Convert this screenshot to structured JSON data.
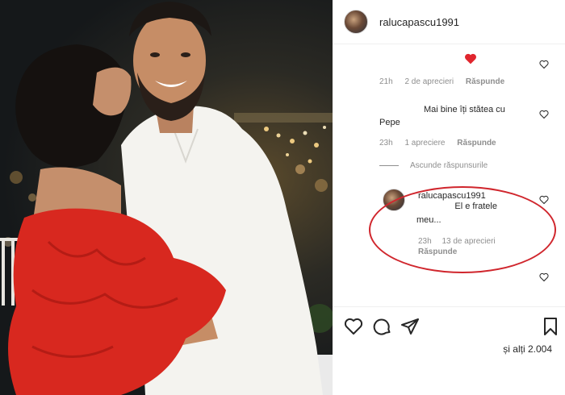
{
  "post": {
    "username": "ralucapascu1991"
  },
  "comments": [
    {
      "text": "",
      "has_red_heart": true,
      "time": "21h",
      "likes": "2 de aprecieri",
      "reply_label": "Răspunde"
    },
    {
      "text_line1": "Mai bine îți stătea cu",
      "text_line2": "Pepe",
      "time": "23h",
      "likes": "1 apreciere",
      "reply_label": "Răspunde"
    }
  ],
  "hide_replies_label": "Ascunde răspunsurile",
  "reply": {
    "username": "ralucapascu1991",
    "text_line1": "El e fratele",
    "text_line2": "meu...",
    "time": "23h",
    "likes": "13 de aprecieri",
    "reply_label": "Răspunde"
  },
  "actions": {
    "like_icon": "heart-outline-icon",
    "comment_icon": "comment-bubble-icon",
    "share_icon": "paper-plane-icon",
    "save_icon": "bookmark-icon"
  },
  "likes_summary": "și alți 2.004",
  "colors": {
    "accent_red": "#ed4956",
    "highlight_red": "#d0262d",
    "muted": "#8e8e8e",
    "text": "#262626"
  }
}
